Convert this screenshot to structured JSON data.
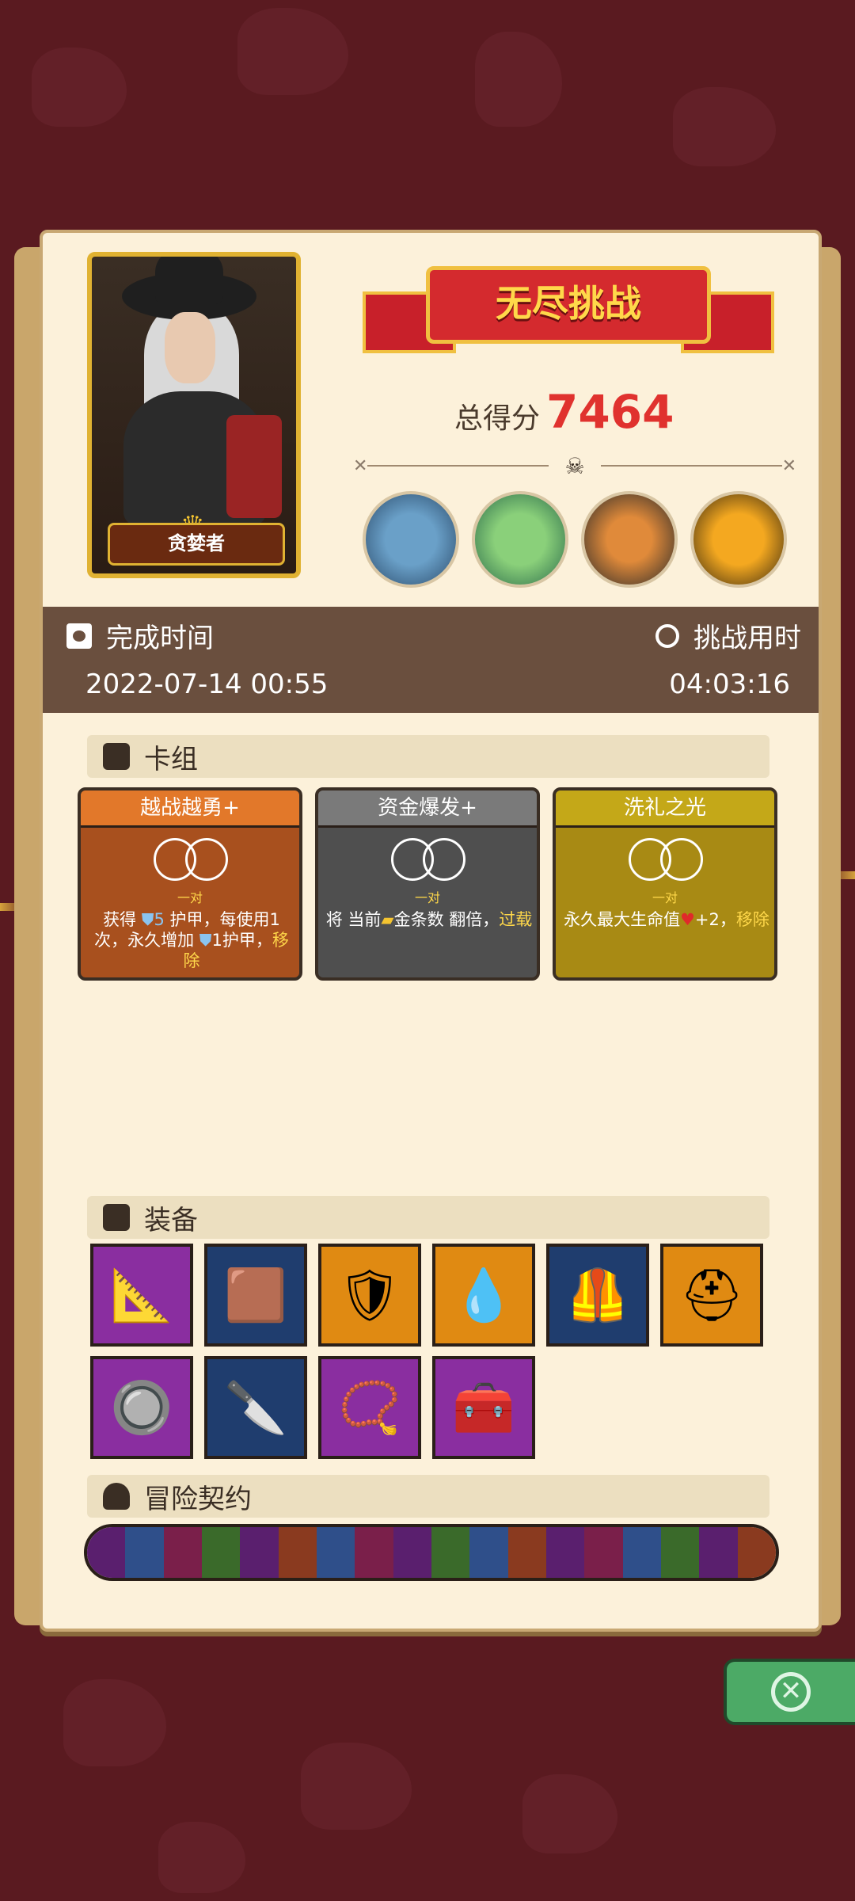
{
  "mode_title": "无尽挑战",
  "score": {
    "label": "总得分",
    "value": "7464"
  },
  "character": {
    "name": "贪婪者"
  },
  "bosses": [
    "blue-ogre-boss",
    "green-goblin-boss",
    "fish-rider-boss",
    "pumpkin-sun-boss"
  ],
  "completion": {
    "label": "完成时间",
    "value": "2022-07-14 00:55"
  },
  "duration": {
    "label": "挑战用时",
    "value": "04:03:16"
  },
  "deck": {
    "title": "卡组",
    "cards": [
      {
        "title": "越战越勇+",
        "pair": "一对",
        "desc_parts": [
          "获得 ",
          "5",
          " 护甲，每使用1次，永久增加 ",
          "1护甲，"
        ],
        "desc_tail": "移除",
        "color": "#a8501e",
        "title_color": "#e2782a"
      },
      {
        "title": "资金爆发+",
        "pair": "一对",
        "desc_parts": [
          "将 当前",
          "金条数 翻倍，"
        ],
        "desc_tail": "过载",
        "color": "#4f4f4f",
        "title_color": "#7a7a7a"
      },
      {
        "title": "洗礼之光",
        "pair": "一对",
        "desc_parts": [
          "永久最大生命值",
          "+2，"
        ],
        "desc_tail": "移除",
        "color": "#a88a14",
        "title_color": "#c4a818"
      }
    ]
  },
  "equipment": {
    "title": "装备",
    "items": [
      {
        "name": "golden-ruler-icon",
        "bg": "#8a2ea0",
        "glyph": "📐"
      },
      {
        "name": "leather-belt-icon",
        "bg": "#1f3d6e",
        "glyph": "🟫"
      },
      {
        "name": "golden-shield-icon",
        "bg": "#e08a12",
        "glyph": "🛡"
      },
      {
        "name": "blue-slime-icon",
        "bg": "#e08a12",
        "glyph": "💧"
      },
      {
        "name": "chest-armor-icon",
        "bg": "#1f3d6e",
        "glyph": "🦺"
      },
      {
        "name": "spiked-helmet-icon",
        "bg": "#e08a12",
        "glyph": "⛑"
      },
      {
        "name": "wooden-button-icon",
        "bg": "#8a2ea0",
        "glyph": "🔘"
      },
      {
        "name": "blade-icon",
        "bg": "#1f3d6e",
        "glyph": "🔪"
      },
      {
        "name": "spiked-bracelet-icon",
        "bg": "#8a2ea0",
        "glyph": "📿"
      },
      {
        "name": "treasure-chest-icon",
        "bg": "#8a2ea0",
        "glyph": "🧰"
      }
    ]
  },
  "contract": {
    "title": "冒险契约"
  },
  "colors": {
    "score": "#e0322e",
    "bar": "#6a4f3e",
    "panel": "#fcf1da",
    "close": "#4caa66"
  }
}
